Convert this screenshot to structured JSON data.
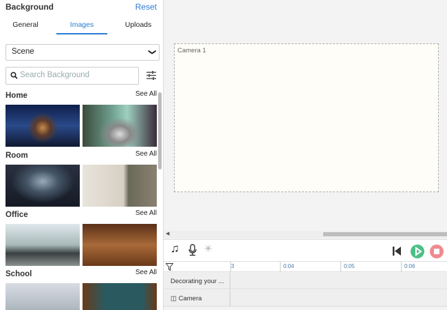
{
  "panel": {
    "title": "Background",
    "reset": "Reset",
    "tabs": [
      "General",
      "Images",
      "Uploads"
    ],
    "active_tab": "Images",
    "select_value": "Scene",
    "search_placeholder": "Search Background",
    "see_all": "See All",
    "categories": [
      {
        "name": "Home"
      },
      {
        "name": "Room"
      },
      {
        "name": "Office"
      },
      {
        "name": "School"
      }
    ]
  },
  "canvas": {
    "label": "Camera 1"
  },
  "timeline": {
    "ticks": [
      "3",
      "0:04",
      "0:05",
      "0:06"
    ],
    "tracks": [
      "Decorating your ...",
      "Camera"
    ]
  },
  "colors": {
    "accent": "#2b7bd4",
    "play": "#4dc087",
    "stop": "#ef8a8f"
  }
}
